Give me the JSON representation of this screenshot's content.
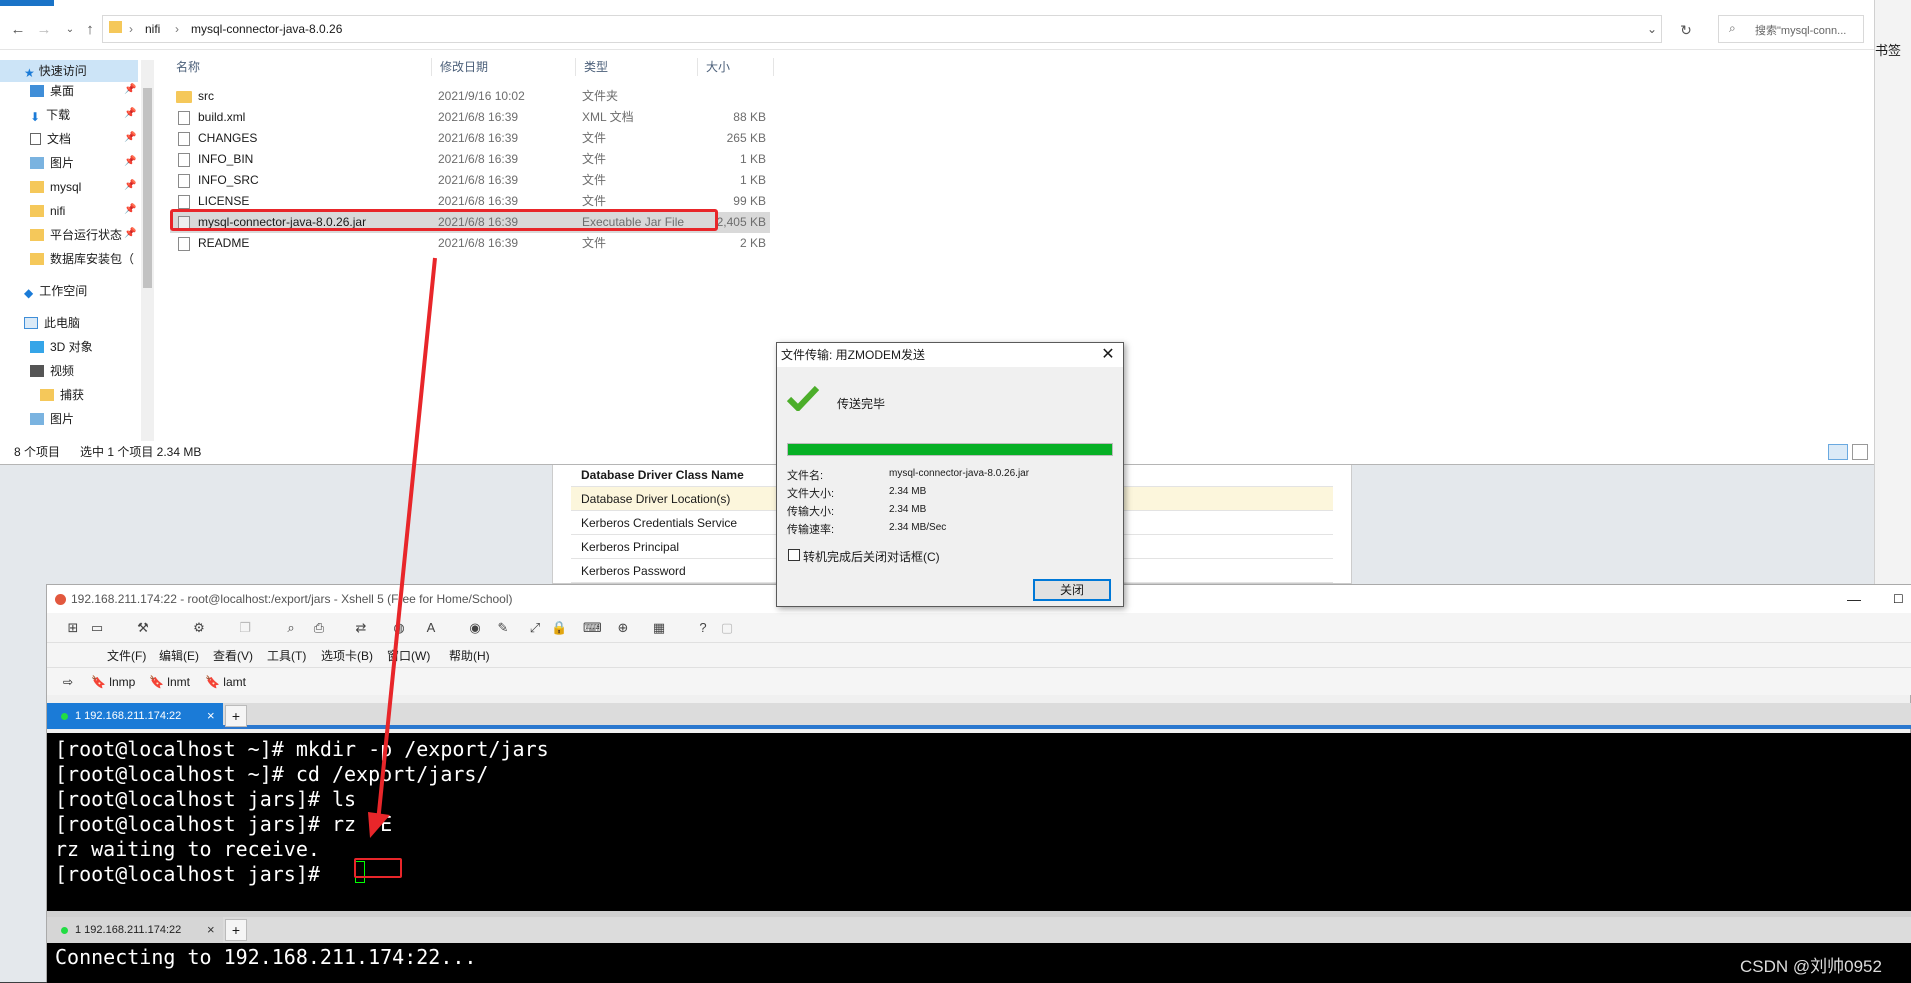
{
  "explorer": {
    "breadcrumb": [
      "nifi",
      "mysql-connector-java-8.0.26"
    ],
    "search_placeholder": "搜索\"mysql-conn...",
    "columns": [
      "名称",
      "修改日期",
      "类型",
      "大小"
    ],
    "sidebar": [
      {
        "label": "快速访问",
        "pinned": false
      },
      {
        "label": "桌面",
        "pinned": true
      },
      {
        "label": "下载",
        "pinned": true
      },
      {
        "label": "文档",
        "pinned": true
      },
      {
        "label": "图片",
        "pinned": true
      },
      {
        "label": "mysql",
        "pinned": true
      },
      {
        "label": "nifi",
        "pinned": true
      },
      {
        "label": "平台运行状态",
        "pinned": true
      },
      {
        "label": "数据库安装包（",
        "pinned": false
      },
      {
        "label": "工作空间",
        "pinned": false
      },
      {
        "label": "此电脑",
        "pinned": false
      },
      {
        "label": "3D 对象",
        "pinned": false
      },
      {
        "label": "视频",
        "pinned": false
      },
      {
        "label": "捕获",
        "pinned": false
      },
      {
        "label": "图片",
        "pinned": false
      }
    ],
    "files": [
      {
        "name": "src",
        "date": "2021/9/16 10:02",
        "type": "文件夹",
        "size": ""
      },
      {
        "name": "build.xml",
        "date": "2021/6/8 16:39",
        "type": "XML 文档",
        "size": "88 KB"
      },
      {
        "name": "CHANGES",
        "date": "2021/6/8 16:39",
        "type": "文件",
        "size": "265 KB"
      },
      {
        "name": "INFO_BIN",
        "date": "2021/6/8 16:39",
        "type": "文件",
        "size": "1 KB"
      },
      {
        "name": "INFO_SRC",
        "date": "2021/6/8 16:39",
        "type": "文件",
        "size": "1 KB"
      },
      {
        "name": "LICENSE",
        "date": "2021/6/8 16:39",
        "type": "文件",
        "size": "99 KB"
      },
      {
        "name": "mysql-connector-java-8.0.26.jar",
        "date": "2021/6/8 16:39",
        "type": "Executable Jar File",
        "size": "2,405 KB"
      },
      {
        "name": "README",
        "date": "2021/6/8 16:39",
        "type": "文件",
        "size": "2 KB"
      }
    ],
    "status": {
      "count": "8 个项目",
      "selected": "选中 1 个项目  2.34 MB"
    }
  },
  "right_edge": {
    "bookmark": "书签"
  },
  "nifi_panel": {
    "rows": [
      "Database Driver Class Name",
      "Database Driver Location(s)",
      "Kerberos Credentials Service",
      "Kerberos Principal",
      "Kerberos Password"
    ]
  },
  "dialog": {
    "title": "文件传输: 用ZMODEM发送",
    "done": "传送完毕",
    "progress": 1.0,
    "progress_color": "#06b025",
    "fields": [
      {
        "key": "文件名:",
        "value": "mysql-connector-java-8.0.26.jar"
      },
      {
        "key": "文件大小:",
        "value": "2.34 MB"
      },
      {
        "key": "传输大小:",
        "value": "2.34 MB"
      },
      {
        "key": "传输速率:",
        "value": "2.34 MB/Sec"
      }
    ],
    "checkbox": "转机完成后关闭对话框(C)",
    "close_button": "关闭"
  },
  "xshell": {
    "title": "192.168.211.174:22 - root@localhost:/export/jars - Xshell 5 (Free for Home/School)",
    "menu": [
      "文件(F)",
      "编辑(E)",
      "查看(V)",
      "工具(T)",
      "选项卡(B)",
      "窗口(W)",
      "帮助(H)"
    ],
    "bookmarks": [
      "lnmp",
      "lnmt",
      "lamt"
    ],
    "tab1": "1 192.168.211.174:22",
    "tab2": "1 192.168.211.174:22",
    "terminal": [
      "[root@localhost ~]# mkdir -p /export/jars",
      "[root@localhost ~]# cd /export/jars/",
      "[root@localhost jars]# ls",
      "[root@localhost jars]# rz -E",
      "rz waiting to receive.",
      "[root@localhost jars]# "
    ],
    "terminal2": "Connecting to 192.168.211.174:22..."
  },
  "watermark": "CSDN @刘帅0952",
  "colors": {
    "accent": "#1b7bd7",
    "highlight": "#e8262a"
  }
}
